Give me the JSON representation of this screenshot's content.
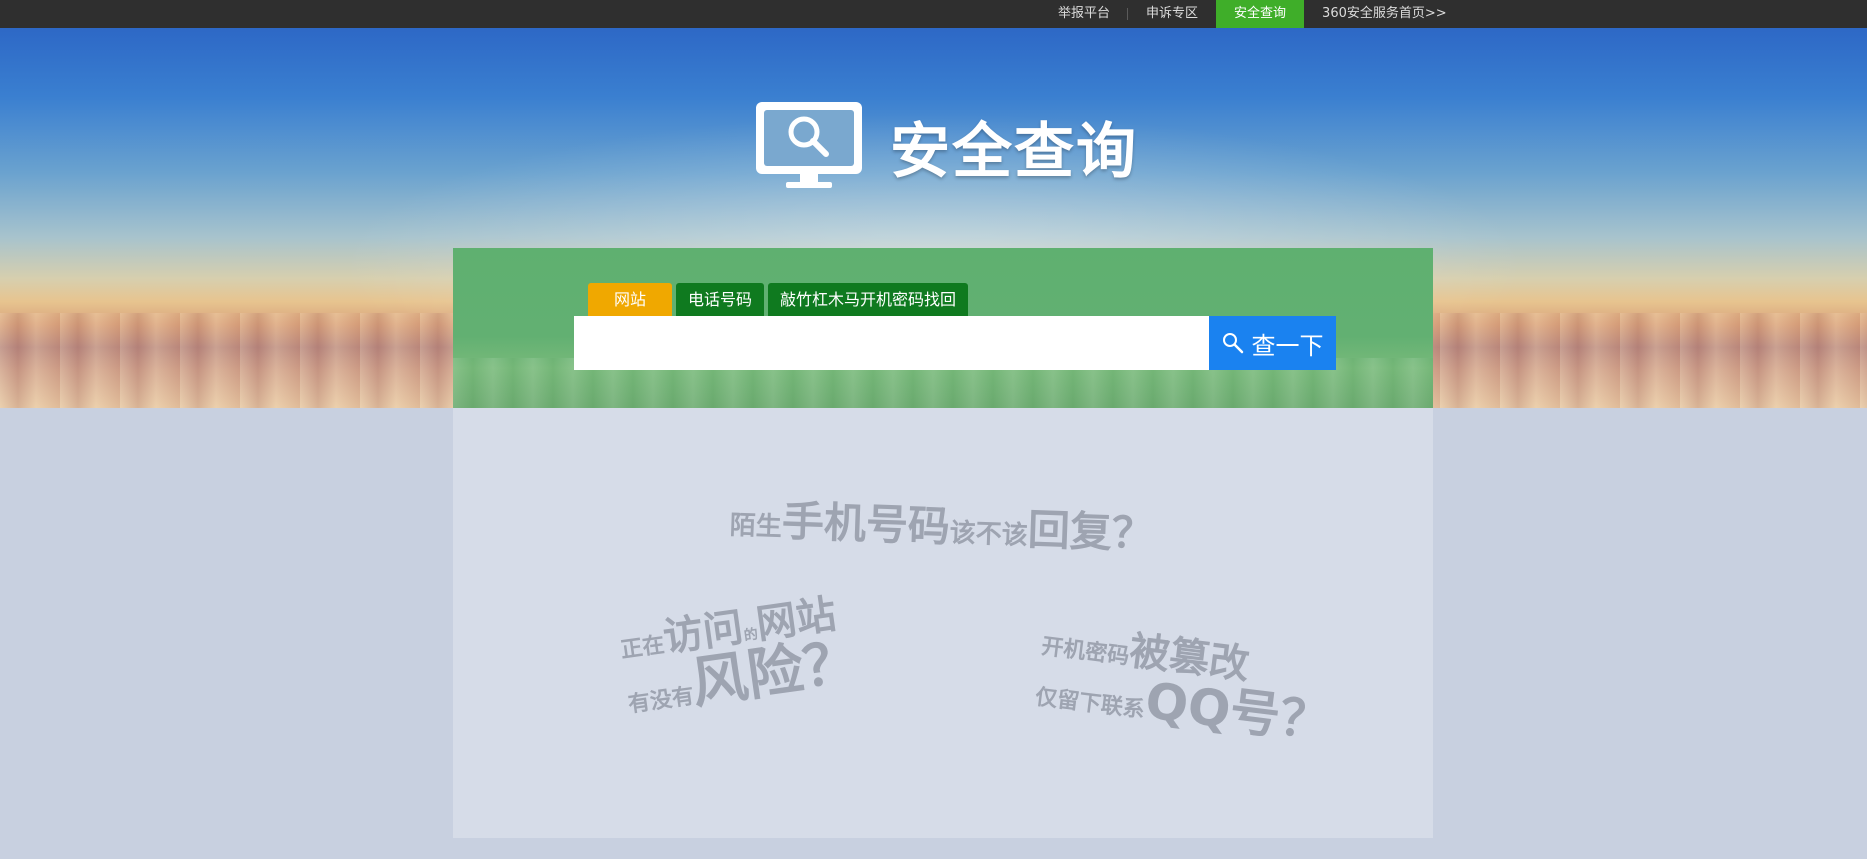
{
  "topnav": {
    "items": [
      {
        "label": "举报平台"
      },
      {
        "label": "申诉专区"
      },
      {
        "label": "安全查询"
      },
      {
        "label": "360安全服务首页>>"
      }
    ]
  },
  "hero": {
    "title": "安全查询",
    "icon": "monitor-search-icon"
  },
  "search": {
    "tabs": [
      {
        "label": "网站"
      },
      {
        "label": "电话号码"
      },
      {
        "label": "敲竹杠木马开机密码找回"
      }
    ],
    "input_value": "",
    "button_label": "查一下",
    "button_icon": "search-icon"
  },
  "slogans": {
    "phone": {
      "p1": "陌生",
      "p2": "手机号码",
      "p3": "该不该",
      "p4": "回复？"
    },
    "site": {
      "p1": "正在",
      "p2": "访问",
      "p3": "的",
      "p4": "网站",
      "p5": "有没有",
      "p6": "风险？"
    },
    "password": {
      "p1": "开机密码",
      "p2": "被篡改",
      "p3": "仅留下联系",
      "p4": "QQ号？"
    }
  },
  "colors": {
    "topbar": "#2f2f2f",
    "active_nav": "#3fae29",
    "active_tab": "#f0a800",
    "tab": "#0f7a1f",
    "search_button": "#1a82f0"
  }
}
